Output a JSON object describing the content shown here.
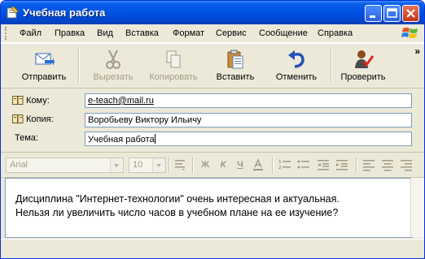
{
  "window": {
    "title": "Учебная работа"
  },
  "menu": [
    "Файл",
    "Правка",
    "Вид",
    "Вставка",
    "Формат",
    "Сервис",
    "Сообщение",
    "Справка"
  ],
  "toolbar": {
    "send": "Отправить",
    "cut": "Вырезать",
    "copy": "Копировать",
    "paste": "Вставить",
    "undo": "Отменить",
    "check": "Проверить"
  },
  "headers": {
    "to_label": "Кому:",
    "to_value": "e-teach@mail.ru",
    "cc_label": "Копия:",
    "cc_value": "Воробьеву Виктору Ильичу",
    "subject_label": "Тема:",
    "subject_value": "Учебная работа"
  },
  "format": {
    "font": "Arial",
    "size": "10",
    "bold": "Ж",
    "italic": "К",
    "underline": "Ч"
  },
  "message": {
    "line1": "Дисциплина \"Интернет-технологии\" очень интересная и актуальная.",
    "line2": "Нельзя ли увеличить число часов в учебном плане на ее изучение?"
  },
  "icons": [
    "app-compose-icon",
    "minimize-icon",
    "maximize-icon",
    "close-icon",
    "windows-logo-icon",
    "send-icon",
    "scissors-icon",
    "copy-icon",
    "paste-icon",
    "undo-icon",
    "spellcheck-icon",
    "address-book-icon"
  ]
}
